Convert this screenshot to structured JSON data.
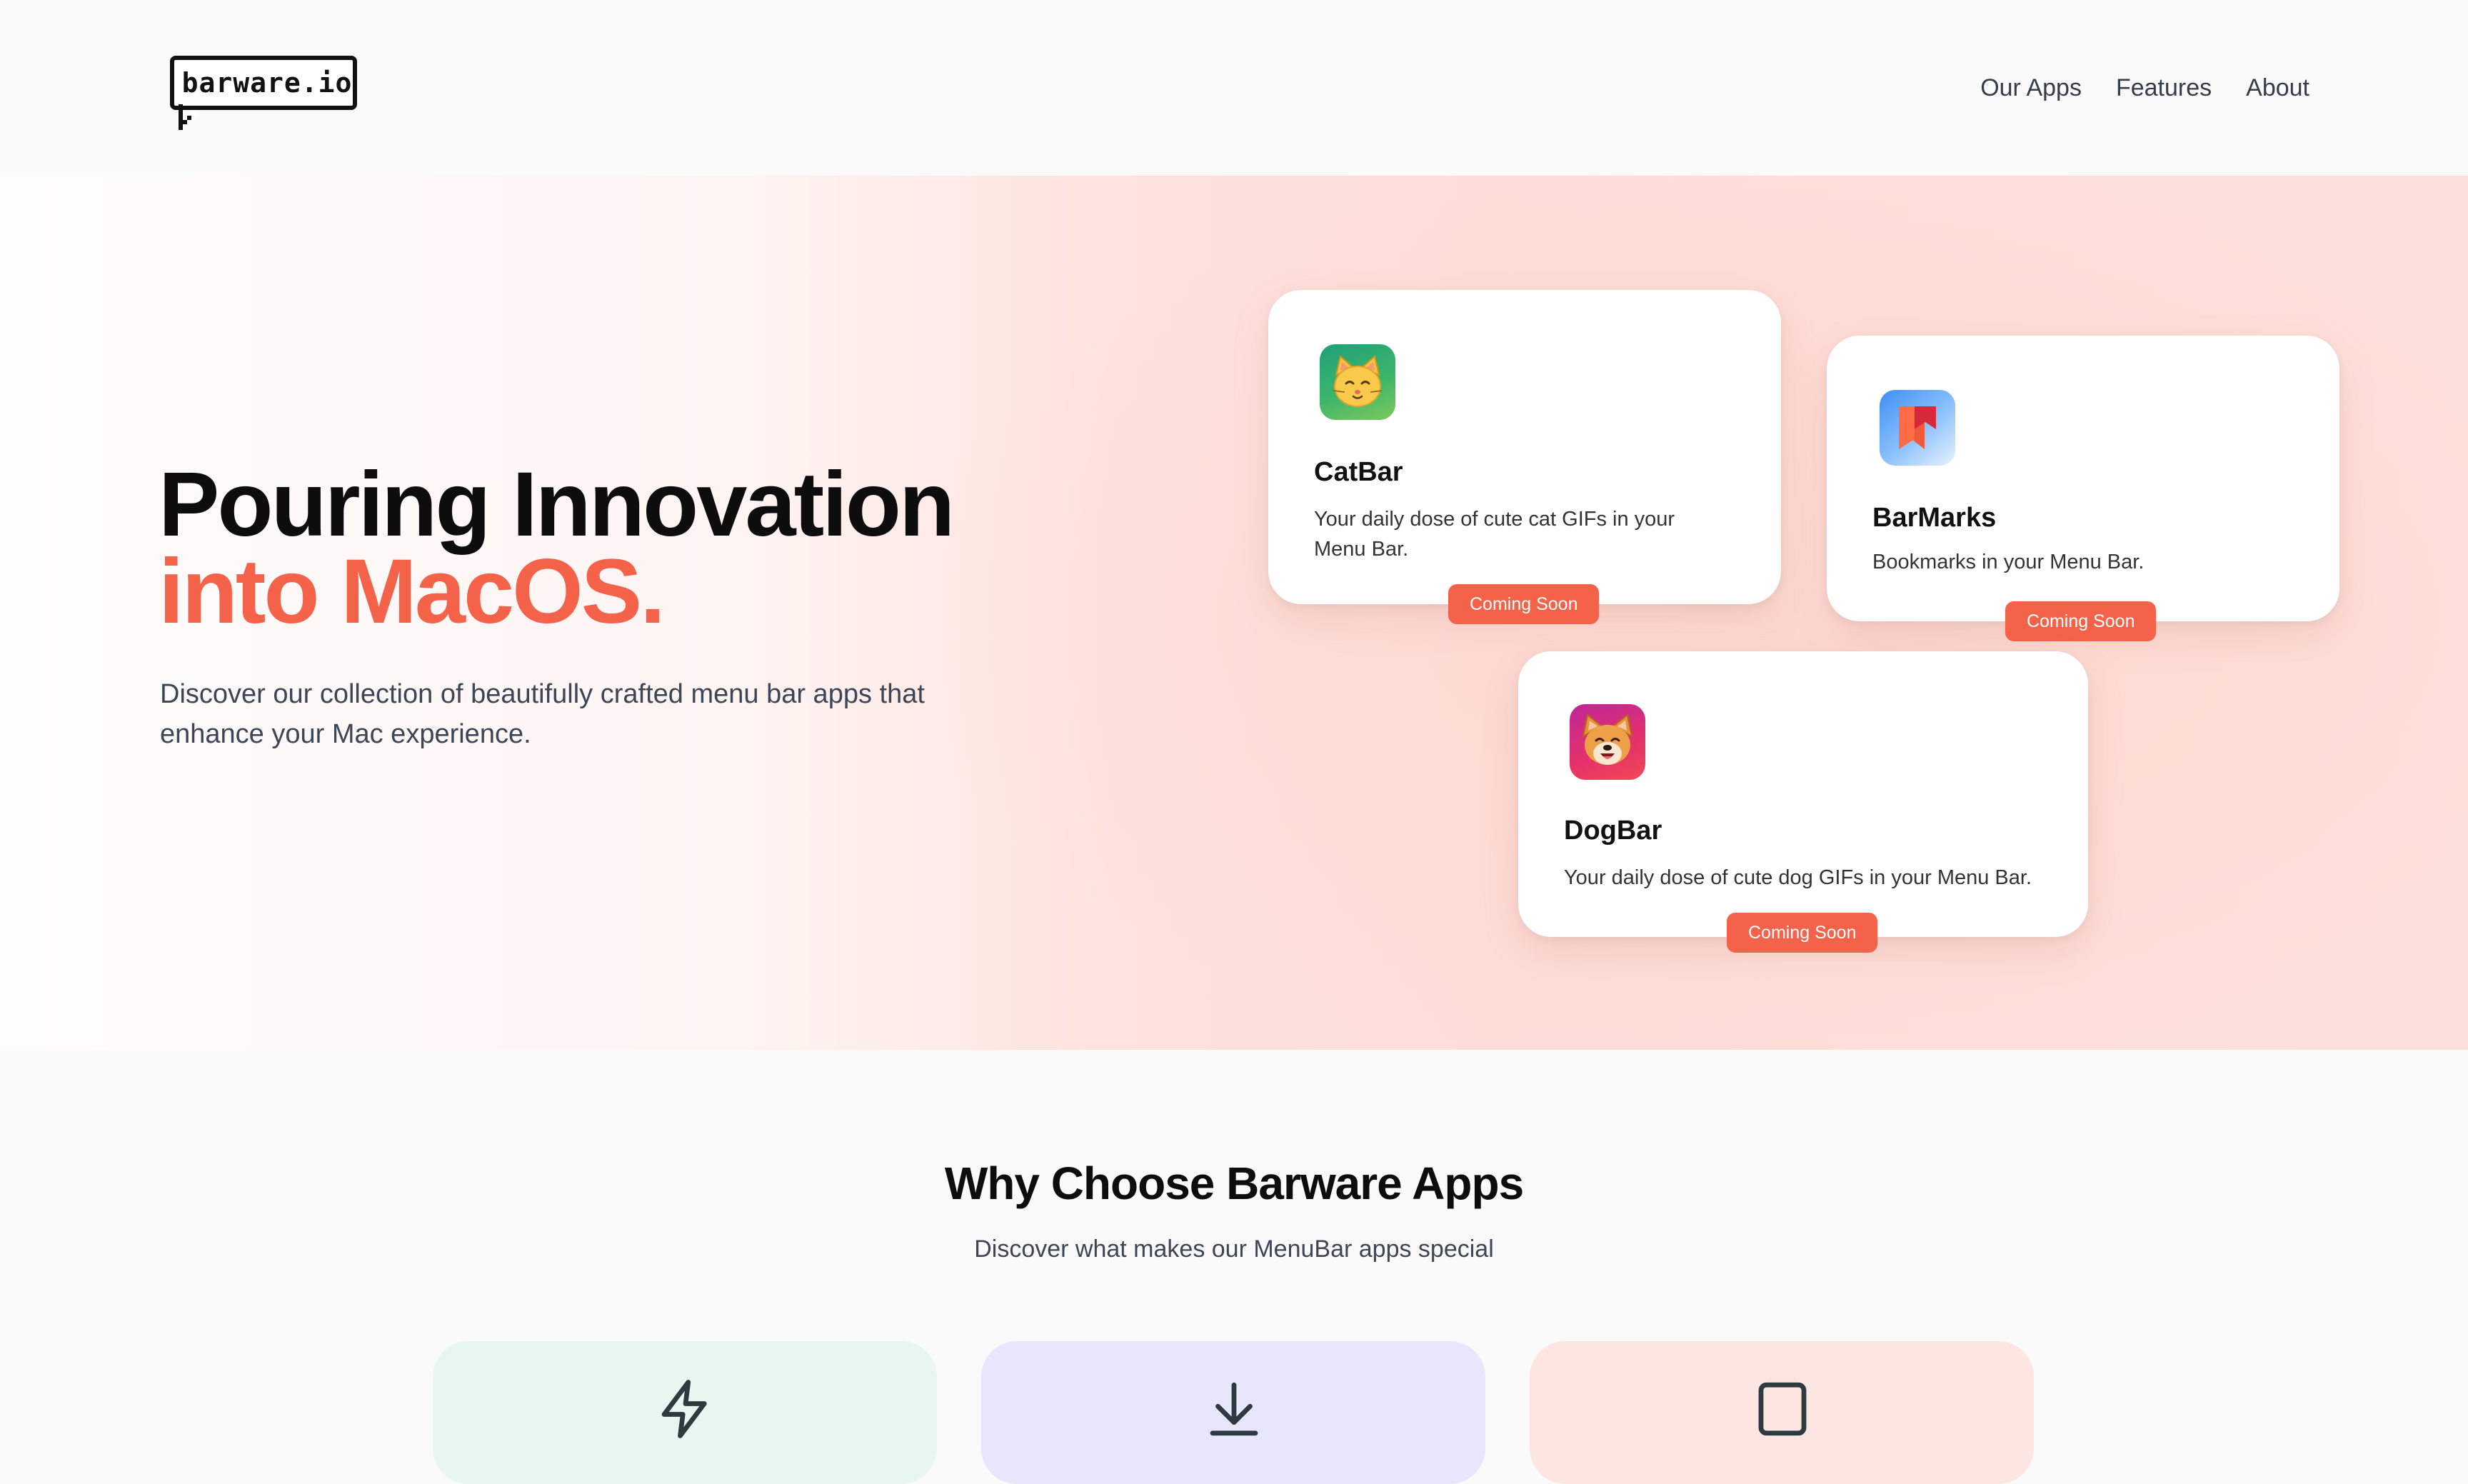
{
  "brand": {
    "logo_text": "barware.io"
  },
  "nav": {
    "items": [
      {
        "label": "Our Apps"
      },
      {
        "label": "Features"
      },
      {
        "label": "About"
      }
    ]
  },
  "hero": {
    "title_line1": "Pouring Innovation",
    "title_line2": "into MacOS.",
    "subtitle": "Discover our collection of beautifully crafted menu bar apps that enhance your Mac experience."
  },
  "apps": [
    {
      "name": "CatBar",
      "description": "Your daily dose of cute cat GIFs in your Menu Bar.",
      "badge": "Coming Soon",
      "icon": "cat-face-icon"
    },
    {
      "name": "BarMarks",
      "description": "Bookmarks in your Menu Bar.",
      "badge": "Coming Soon",
      "icon": "bookmark-icon"
    },
    {
      "name": "DogBar",
      "description": "Your daily dose of cute dog GIFs in your Menu Bar.",
      "badge": "Coming Soon",
      "icon": "dog-face-icon"
    }
  ],
  "why": {
    "title": "Why Choose Barware Apps",
    "subtitle": "Discover what makes our MenuBar apps special",
    "features": [
      {
        "icon": "lightning-icon"
      },
      {
        "icon": "download-icon"
      },
      {
        "icon": "window-icon"
      }
    ]
  },
  "colors": {
    "accent": "#f4624a",
    "hero_bg": "#fde0da",
    "feature_green": "#e7f7ef",
    "feature_purple": "#e8e6fb",
    "feature_peach": "#fde6e1"
  }
}
